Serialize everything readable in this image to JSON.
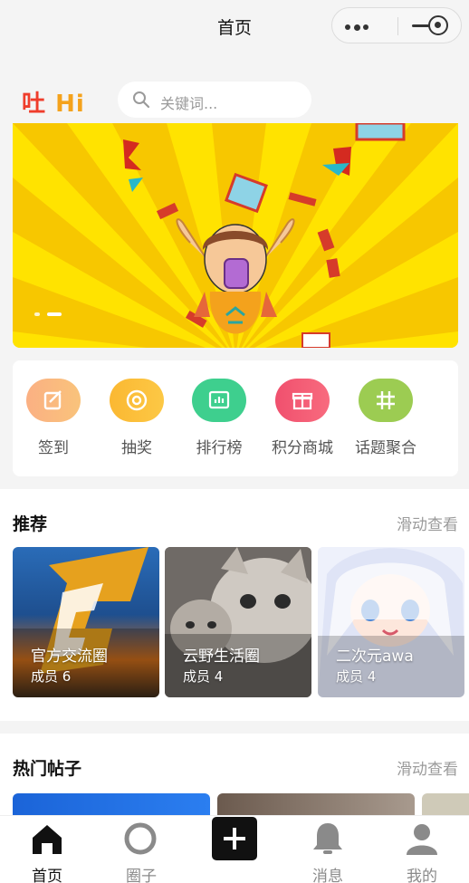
{
  "navbar": {
    "title": "首页"
  },
  "header": {
    "logo_part1": "吐",
    "logo_part2": "Hi",
    "search_placeholder": "关键词..."
  },
  "quick_actions": [
    {
      "label": "签到",
      "icon": "edit-icon",
      "color": "#f9a06b"
    },
    {
      "label": "抽奖",
      "icon": "target-icon",
      "color": "#fbb832"
    },
    {
      "label": "排行榜",
      "icon": "chart-icon",
      "color": "#3ecf8e"
    },
    {
      "label": "积分商城",
      "icon": "gift-icon",
      "color": "#f0506e"
    },
    {
      "label": "话题聚合",
      "icon": "hash-icon",
      "color": "#9ccc52"
    }
  ],
  "recommend": {
    "title": "推荐",
    "more": "滑动查看",
    "cards": [
      {
        "name": "官方交流圈",
        "members": "成员 6"
      },
      {
        "name": "云野生活圈",
        "members": "成员 4"
      },
      {
        "name": "二次元awa",
        "members": "成员 4"
      }
    ]
  },
  "hot_posts": {
    "title": "热门帖子",
    "more": "滑动查看"
  },
  "tabbar": [
    {
      "label": "首页",
      "icon": "home-icon",
      "active": true
    },
    {
      "label": "圈子",
      "icon": "circle-icon",
      "active": false
    },
    {
      "label": "",
      "icon": "plus-icon",
      "active": false
    },
    {
      "label": "消息",
      "icon": "bell-icon",
      "active": false
    },
    {
      "label": "我的",
      "icon": "user-icon",
      "active": false
    }
  ],
  "colors": {
    "banner_background": "#ffe300",
    "logo_red": "#ef3d2b",
    "logo_orange": "#f4a21c"
  }
}
